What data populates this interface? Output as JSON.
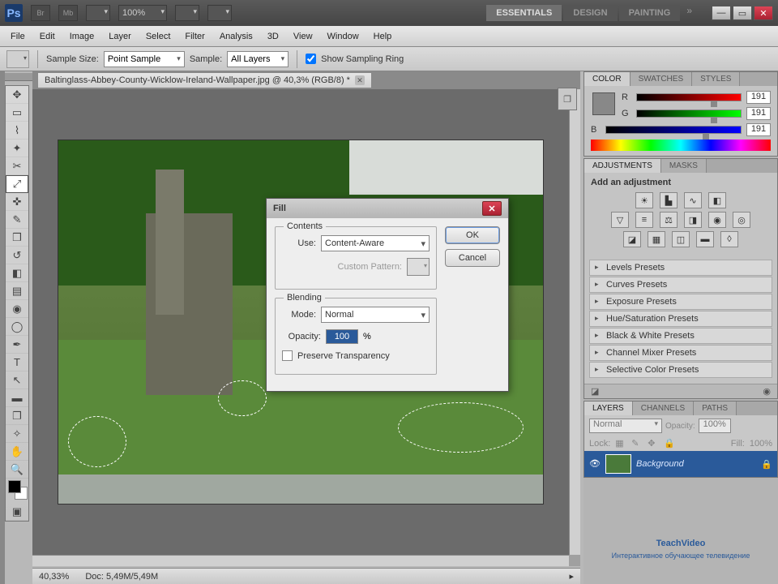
{
  "app_bar": {
    "zoom": "100%",
    "workspaces": [
      "ESSENTIALS",
      "DESIGN",
      "PAINTING"
    ],
    "active_workspace": 0
  },
  "menu": [
    "File",
    "Edit",
    "Image",
    "Layer",
    "Select",
    "Filter",
    "Analysis",
    "3D",
    "View",
    "Window",
    "Help"
  ],
  "options": {
    "sample_size_label": "Sample Size:",
    "sample_size_value": "Point Sample",
    "sample_label": "Sample:",
    "sample_value": "All Layers",
    "show_ring_label": "Show Sampling Ring"
  },
  "document": {
    "tab_title": "Baltinglass-Abbey-County-Wicklow-Ireland-Wallpaper.jpg @ 40,3% (RGB/8) *"
  },
  "status": {
    "zoom": "40,33%",
    "doc": "Doc: 5,49M/5,49M"
  },
  "color_panel": {
    "tabs": [
      "COLOR",
      "SWATCHES",
      "STYLES"
    ],
    "r_label": "R",
    "r_value": "191",
    "g_label": "G",
    "g_value": "191",
    "b_label": "B",
    "b_value": "191"
  },
  "adjustments_panel": {
    "tabs": [
      "ADJUSTMENTS",
      "MASKS"
    ],
    "hint": "Add an adjustment",
    "presets": [
      "Levels Presets",
      "Curves Presets",
      "Exposure Presets",
      "Hue/Saturation Presets",
      "Black & White Presets",
      "Channel Mixer Presets",
      "Selective Color Presets"
    ]
  },
  "layers_panel": {
    "tabs": [
      "LAYERS",
      "CHANNELS",
      "PATHS"
    ],
    "blend_mode": "Normal",
    "opacity_label": "Opacity:",
    "opacity_value": "100%",
    "lock_label": "Lock:",
    "fill_label": "Fill:",
    "fill_value": "100%",
    "layer_name": "Background"
  },
  "dialog": {
    "title": "Fill",
    "ok": "OK",
    "cancel": "Cancel",
    "contents_legend": "Contents",
    "use_label": "Use:",
    "use_value": "Content-Aware",
    "pattern_label": "Custom Pattern:",
    "blending_legend": "Blending",
    "mode_label": "Mode:",
    "mode_value": "Normal",
    "opacity_label": "Opacity:",
    "opacity_value": "100",
    "opacity_unit": "%",
    "preserve_label": "Preserve Transparency"
  },
  "brand": {
    "line1a": "Teach",
    "line1b": "Video",
    "line2": "Интерактивное обучающее телевидение"
  }
}
